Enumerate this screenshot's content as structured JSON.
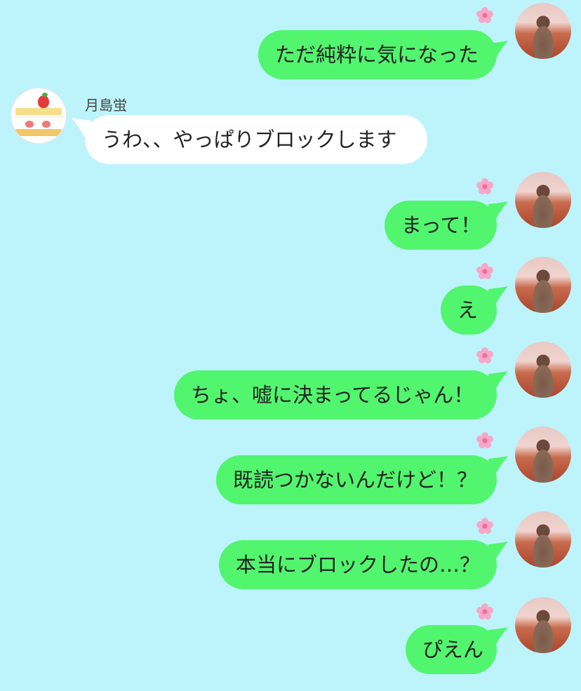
{
  "contact": {
    "name": "月島蛍",
    "avatar_icon": "shortcake-icon"
  },
  "me": {
    "avatar_icon": "girl-in-flower-field-icon",
    "reaction_icon": "cherry-blossom-icon"
  },
  "colors": {
    "background": "#bdf4fc",
    "my_bubble": "#52f56e",
    "their_bubble": "#ffffff"
  },
  "messages": [
    {
      "from": "me",
      "text": "ただ純粋に気になった"
    },
    {
      "from": "them",
      "text": "うわ、、やっぱりブロックします"
    },
    {
      "from": "me",
      "text": "まって！"
    },
    {
      "from": "me",
      "text": "え"
    },
    {
      "from": "me",
      "text": "ちょ、嘘に決まってるじゃん！"
    },
    {
      "from": "me",
      "text": "既読つかないんだけど！？"
    },
    {
      "from": "me",
      "text": "本当にブロックしたの…？"
    },
    {
      "from": "me",
      "text": "ぴえん"
    }
  ]
}
